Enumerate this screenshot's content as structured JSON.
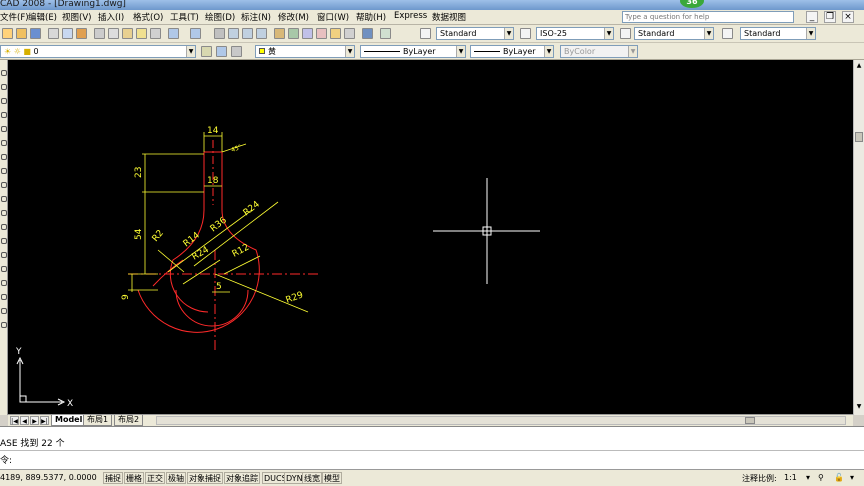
{
  "window": {
    "title": "CAD 2008 - [Drawing1.dwg]",
    "badge": "36"
  },
  "menu": {
    "items": [
      "文件(F)",
      "编辑(E)",
      "视图(V)",
      "插入(I)",
      "格式(O)",
      "工具(T)",
      "绘图(D)",
      "标注(N)",
      "修改(M)",
      "窗口(W)",
      "帮助(H)",
      "Express",
      "数据视图"
    ],
    "help_placeholder": "Type a question for help"
  },
  "toolbar": {
    "text_style": "Standard",
    "dim_style": "ISO-25",
    "table_style": "Standard",
    "mleader_style": "Standard"
  },
  "properties_bar": {
    "layer": "0",
    "color": "黄",
    "linetype": "ByLayer",
    "lineweight": "ByLayer",
    "plot_style": "ByColor"
  },
  "drawing": {
    "dimensions": [
      "14",
      "18",
      "23",
      "54",
      "9",
      "R2",
      "R14",
      "R36",
      "R24",
      "R24",
      "R12",
      "5",
      "R29",
      "45°"
    ],
    "ucs_y": "Y",
    "ucs_x": "X"
  },
  "layout_tabs": [
    "Model",
    "布局1",
    "布局2"
  ],
  "command": {
    "history": "ASE 找到 22 个",
    "prompt": "令:"
  },
  "status": {
    "coords": "4189, 889.5377, 0.0000",
    "toggles": [
      "捕捉",
      "栅格",
      "正交",
      "极轴",
      "对象捕捉",
      "对象追踪",
      "DUCS",
      "DYN",
      "线宽",
      "模型"
    ],
    "annotation_scale_label": "注释比例:",
    "annotation_scale": "1:1"
  },
  "colors": {
    "canvas": "#000000",
    "geometry": "#ff2a2a",
    "dimension": "#ffff33",
    "crosshair": "#ffffff"
  }
}
